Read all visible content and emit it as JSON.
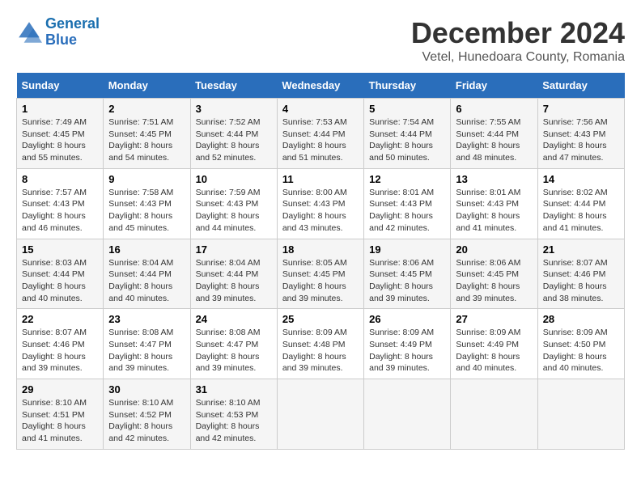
{
  "logo": {
    "line1": "General",
    "line2": "Blue"
  },
  "title": "December 2024",
  "subtitle": "Vetel, Hunedoara County, Romania",
  "days_of_week": [
    "Sunday",
    "Monday",
    "Tuesday",
    "Wednesday",
    "Thursday",
    "Friday",
    "Saturday"
  ],
  "weeks": [
    [
      {
        "day": 1,
        "text": "Sunrise: 7:49 AM\nSunset: 4:45 PM\nDaylight: 8 hours\nand 55 minutes."
      },
      {
        "day": 2,
        "text": "Sunrise: 7:51 AM\nSunset: 4:45 PM\nDaylight: 8 hours\nand 54 minutes."
      },
      {
        "day": 3,
        "text": "Sunrise: 7:52 AM\nSunset: 4:44 PM\nDaylight: 8 hours\nand 52 minutes."
      },
      {
        "day": 4,
        "text": "Sunrise: 7:53 AM\nSunset: 4:44 PM\nDaylight: 8 hours\nand 51 minutes."
      },
      {
        "day": 5,
        "text": "Sunrise: 7:54 AM\nSunset: 4:44 PM\nDaylight: 8 hours\nand 50 minutes."
      },
      {
        "day": 6,
        "text": "Sunrise: 7:55 AM\nSunset: 4:44 PM\nDaylight: 8 hours\nand 48 minutes."
      },
      {
        "day": 7,
        "text": "Sunrise: 7:56 AM\nSunset: 4:43 PM\nDaylight: 8 hours\nand 47 minutes."
      }
    ],
    [
      {
        "day": 8,
        "text": "Sunrise: 7:57 AM\nSunset: 4:43 PM\nDaylight: 8 hours\nand 46 minutes."
      },
      {
        "day": 9,
        "text": "Sunrise: 7:58 AM\nSunset: 4:43 PM\nDaylight: 8 hours\nand 45 minutes."
      },
      {
        "day": 10,
        "text": "Sunrise: 7:59 AM\nSunset: 4:43 PM\nDaylight: 8 hours\nand 44 minutes."
      },
      {
        "day": 11,
        "text": "Sunrise: 8:00 AM\nSunset: 4:43 PM\nDaylight: 8 hours\nand 43 minutes."
      },
      {
        "day": 12,
        "text": "Sunrise: 8:01 AM\nSunset: 4:43 PM\nDaylight: 8 hours\nand 42 minutes."
      },
      {
        "day": 13,
        "text": "Sunrise: 8:01 AM\nSunset: 4:43 PM\nDaylight: 8 hours\nand 41 minutes."
      },
      {
        "day": 14,
        "text": "Sunrise: 8:02 AM\nSunset: 4:44 PM\nDaylight: 8 hours\nand 41 minutes."
      }
    ],
    [
      {
        "day": 15,
        "text": "Sunrise: 8:03 AM\nSunset: 4:44 PM\nDaylight: 8 hours\nand 40 minutes."
      },
      {
        "day": 16,
        "text": "Sunrise: 8:04 AM\nSunset: 4:44 PM\nDaylight: 8 hours\nand 40 minutes."
      },
      {
        "day": 17,
        "text": "Sunrise: 8:04 AM\nSunset: 4:44 PM\nDaylight: 8 hours\nand 39 minutes."
      },
      {
        "day": 18,
        "text": "Sunrise: 8:05 AM\nSunset: 4:45 PM\nDaylight: 8 hours\nand 39 minutes."
      },
      {
        "day": 19,
        "text": "Sunrise: 8:06 AM\nSunset: 4:45 PM\nDaylight: 8 hours\nand 39 minutes."
      },
      {
        "day": 20,
        "text": "Sunrise: 8:06 AM\nSunset: 4:45 PM\nDaylight: 8 hours\nand 39 minutes."
      },
      {
        "day": 21,
        "text": "Sunrise: 8:07 AM\nSunset: 4:46 PM\nDaylight: 8 hours\nand 38 minutes."
      }
    ],
    [
      {
        "day": 22,
        "text": "Sunrise: 8:07 AM\nSunset: 4:46 PM\nDaylight: 8 hours\nand 39 minutes."
      },
      {
        "day": 23,
        "text": "Sunrise: 8:08 AM\nSunset: 4:47 PM\nDaylight: 8 hours\nand 39 minutes."
      },
      {
        "day": 24,
        "text": "Sunrise: 8:08 AM\nSunset: 4:47 PM\nDaylight: 8 hours\nand 39 minutes."
      },
      {
        "day": 25,
        "text": "Sunrise: 8:09 AM\nSunset: 4:48 PM\nDaylight: 8 hours\nand 39 minutes."
      },
      {
        "day": 26,
        "text": "Sunrise: 8:09 AM\nSunset: 4:49 PM\nDaylight: 8 hours\nand 39 minutes."
      },
      {
        "day": 27,
        "text": "Sunrise: 8:09 AM\nSunset: 4:49 PM\nDaylight: 8 hours\nand 40 minutes."
      },
      {
        "day": 28,
        "text": "Sunrise: 8:09 AM\nSunset: 4:50 PM\nDaylight: 8 hours\nand 40 minutes."
      }
    ],
    [
      {
        "day": 29,
        "text": "Sunrise: 8:10 AM\nSunset: 4:51 PM\nDaylight: 8 hours\nand 41 minutes."
      },
      {
        "day": 30,
        "text": "Sunrise: 8:10 AM\nSunset: 4:52 PM\nDaylight: 8 hours\nand 42 minutes."
      },
      {
        "day": 31,
        "text": "Sunrise: 8:10 AM\nSunset: 4:53 PM\nDaylight: 8 hours\nand 42 minutes."
      },
      null,
      null,
      null,
      null
    ]
  ]
}
